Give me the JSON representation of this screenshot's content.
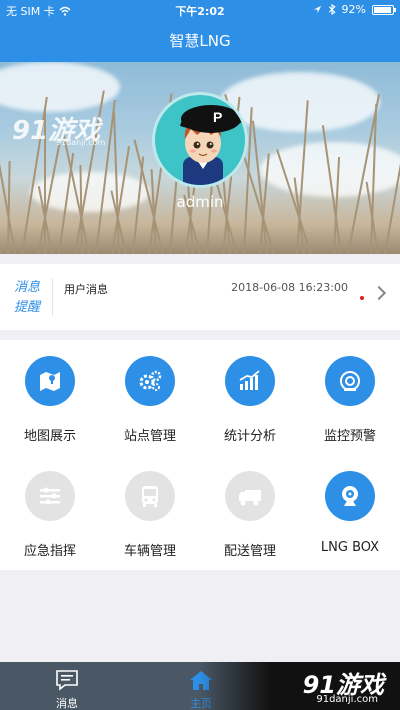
{
  "status_bar": {
    "carrier": "无 SIM 卡",
    "time": "下午2:02",
    "battery_text": "92%",
    "battery_level": 0.92
  },
  "header": {
    "title": "智慧LNG"
  },
  "banner": {
    "username": "admin",
    "watermark_logo": "91游戏",
    "watermark_url": "91danji.com"
  },
  "message": {
    "label": "消息提醒",
    "title": "用户消息",
    "time": "2018-06-08 16:23:00"
  },
  "grid": {
    "items": [
      {
        "label": "地图展示",
        "icon": "map-icon",
        "active": true
      },
      {
        "label": "站点管理",
        "icon": "gears-icon",
        "active": true
      },
      {
        "label": "统计分析",
        "icon": "chart-icon",
        "active": true
      },
      {
        "label": "监控预警",
        "icon": "alarm-icon",
        "active": true
      },
      {
        "label": "应急指挥",
        "icon": "sliders-icon",
        "active": false
      },
      {
        "label": "车辆管理",
        "icon": "bus-icon",
        "active": false
      },
      {
        "label": "配送管理",
        "icon": "truck-icon",
        "active": false
      },
      {
        "label": "LNG BOX",
        "icon": "camera-icon",
        "active": true
      }
    ]
  },
  "tabbar": {
    "tabs": [
      {
        "label": "消息",
        "icon": "message-icon"
      },
      {
        "label": "主页",
        "icon": "home-icon"
      }
    ],
    "watermark_logo": "91游戏",
    "watermark_url": "91danji.com"
  },
  "colors": {
    "accent": "#2e8fe6",
    "tabbar": "#4a5764",
    "inactive": "#e3e3e3"
  }
}
